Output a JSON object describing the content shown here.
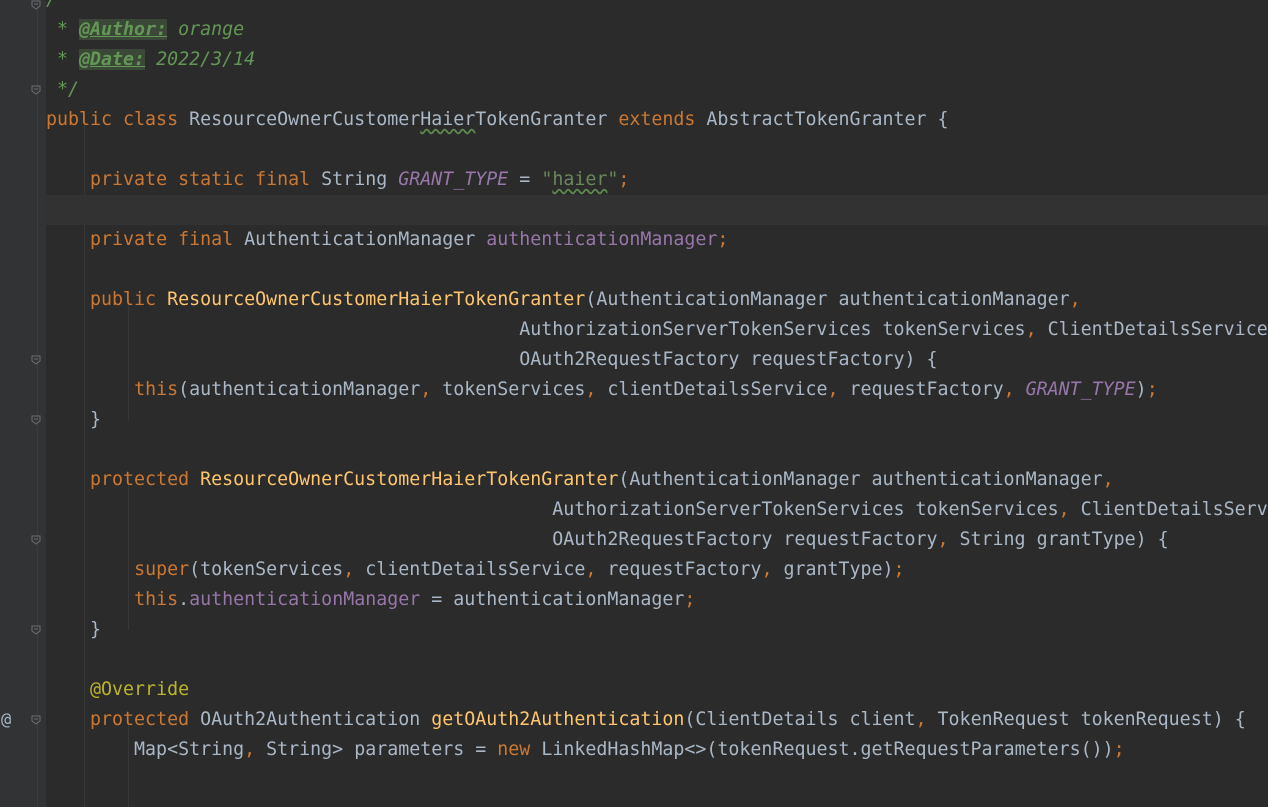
{
  "editor": {
    "gutter_marker": "@",
    "lines": [
      {
        "tokens": [
          {
            "c": "cmt",
            "t": "/**"
          }
        ]
      },
      {
        "tokens": [
          {
            "c": "cmt",
            "t": " * "
          },
          {
            "c": "tag",
            "t": "@Author:"
          },
          {
            "c": "cmt",
            "t": " orange"
          }
        ]
      },
      {
        "tokens": [
          {
            "c": "cmt",
            "t": " * "
          },
          {
            "c": "tag",
            "t": "@Date:"
          },
          {
            "c": "cmt",
            "t": " 2022/3/14"
          }
        ]
      },
      {
        "tokens": [
          {
            "c": "cmt",
            "t": " */"
          }
        ]
      },
      {
        "tokens": [
          {
            "c": "kw",
            "t": "public class "
          },
          {
            "c": "pl",
            "t": "ResourceOwnerCustomer"
          },
          {
            "c": "pl typo",
            "t": "Haier"
          },
          {
            "c": "pl",
            "t": "TokenGranter "
          },
          {
            "c": "kw",
            "t": "extends "
          },
          {
            "c": "pl",
            "t": "AbstractTokenGranter {"
          }
        ]
      },
      {
        "tokens": []
      },
      {
        "tokens": [
          {
            "c": "pl",
            "t": "    "
          },
          {
            "c": "kw",
            "t": "private static final "
          },
          {
            "c": "pl",
            "t": "String "
          },
          {
            "c": "cst",
            "t": "GRANT_TYPE"
          },
          {
            "c": "pl",
            "t": " = "
          },
          {
            "c": "str",
            "t": "\""
          },
          {
            "c": "str typo",
            "t": "haier"
          },
          {
            "c": "str",
            "t": "\""
          },
          {
            "c": "kw",
            "t": ";"
          }
        ]
      },
      {
        "tokens": [],
        "current": true
      },
      {
        "tokens": [
          {
            "c": "pl",
            "t": "    "
          },
          {
            "c": "kw",
            "t": "private final "
          },
          {
            "c": "pl",
            "t": "AuthenticationManager "
          },
          {
            "c": "fld",
            "t": "authenticationManager"
          },
          {
            "c": "kw",
            "t": ";"
          }
        ]
      },
      {
        "tokens": []
      },
      {
        "tokens": [
          {
            "c": "pl",
            "t": "    "
          },
          {
            "c": "kw",
            "t": "public "
          },
          {
            "c": "fn",
            "t": "ResourceOwnerCustomerHaierTokenGranter"
          },
          {
            "c": "pl",
            "t": "(AuthenticationManager authenticationManager"
          },
          {
            "c": "kw",
            "t": ","
          }
        ]
      },
      {
        "tokens": [
          {
            "c": "pl",
            "t": "                                           AuthorizationServerTokenServices tokenServices"
          },
          {
            "c": "kw",
            "t": ", "
          },
          {
            "c": "pl",
            "t": "ClientDetailsService clientDetailsService"
          },
          {
            "c": "kw",
            "t": ","
          }
        ]
      },
      {
        "tokens": [
          {
            "c": "pl",
            "t": "                                           OAuth2RequestFactory requestFactory) {"
          }
        ]
      },
      {
        "tokens": [
          {
            "c": "pl",
            "t": "        "
          },
          {
            "c": "kw",
            "t": "this"
          },
          {
            "c": "pl",
            "t": "(authenticationManager"
          },
          {
            "c": "kw",
            "t": ", "
          },
          {
            "c": "pl",
            "t": "tokenServices"
          },
          {
            "c": "kw",
            "t": ", "
          },
          {
            "c": "pl",
            "t": "clientDetailsService"
          },
          {
            "c": "kw",
            "t": ", "
          },
          {
            "c": "pl",
            "t": "requestFactory"
          },
          {
            "c": "kw",
            "t": ", "
          },
          {
            "c": "cst",
            "t": "GRANT_TYPE"
          },
          {
            "c": "pl",
            "t": ")"
          },
          {
            "c": "kw",
            "t": ";"
          }
        ]
      },
      {
        "tokens": [
          {
            "c": "pl",
            "t": "    }"
          }
        ]
      },
      {
        "tokens": []
      },
      {
        "tokens": [
          {
            "c": "pl",
            "t": "    "
          },
          {
            "c": "kw",
            "t": "protected "
          },
          {
            "c": "fn",
            "t": "ResourceOwnerCustomerHaierTokenGranter"
          },
          {
            "c": "pl",
            "t": "(AuthenticationManager authenticationManager"
          },
          {
            "c": "kw",
            "t": ","
          }
        ]
      },
      {
        "tokens": [
          {
            "c": "pl",
            "t": "                                              AuthorizationServerTokenServices tokenServices"
          },
          {
            "c": "kw",
            "t": ", "
          },
          {
            "c": "pl",
            "t": "ClientDetailsService clientDetailsService"
          },
          {
            "c": "kw",
            "t": ","
          }
        ]
      },
      {
        "tokens": [
          {
            "c": "pl",
            "t": "                                              OAuth2RequestFactory requestFactory"
          },
          {
            "c": "kw",
            "t": ", "
          },
          {
            "c": "pl",
            "t": "String grantType) {"
          }
        ]
      },
      {
        "tokens": [
          {
            "c": "pl",
            "t": "        "
          },
          {
            "c": "kw",
            "t": "super"
          },
          {
            "c": "pl",
            "t": "(tokenServices"
          },
          {
            "c": "kw",
            "t": ", "
          },
          {
            "c": "pl",
            "t": "clientDetailsService"
          },
          {
            "c": "kw",
            "t": ", "
          },
          {
            "c": "pl",
            "t": "requestFactory"
          },
          {
            "c": "kw",
            "t": ", "
          },
          {
            "c": "pl",
            "t": "grantType)"
          },
          {
            "c": "kw",
            "t": ";"
          }
        ]
      },
      {
        "tokens": [
          {
            "c": "pl",
            "t": "        "
          },
          {
            "c": "kw",
            "t": "this"
          },
          {
            "c": "pl",
            "t": "."
          },
          {
            "c": "fld",
            "t": "authenticationManager"
          },
          {
            "c": "pl",
            "t": " = authenticationManager"
          },
          {
            "c": "kw",
            "t": ";"
          }
        ]
      },
      {
        "tokens": [
          {
            "c": "pl",
            "t": "    }"
          }
        ]
      },
      {
        "tokens": []
      },
      {
        "tokens": [
          {
            "c": "pl",
            "t": "    "
          },
          {
            "c": "ann",
            "t": "@Override"
          }
        ]
      },
      {
        "tokens": [
          {
            "c": "pl",
            "t": "    "
          },
          {
            "c": "kw",
            "t": "protected "
          },
          {
            "c": "pl",
            "t": "OAuth2Authentication "
          },
          {
            "c": "fn",
            "t": "getOAuth2Authentication"
          },
          {
            "c": "pl",
            "t": "(ClientDetails client"
          },
          {
            "c": "kw",
            "t": ", "
          },
          {
            "c": "pl",
            "t": "TokenRequest tokenRequest) {"
          }
        ]
      },
      {
        "tokens": [
          {
            "c": "pl",
            "t": "        Map<String"
          },
          {
            "c": "kw",
            "t": ", "
          },
          {
            "c": "pl",
            "t": "String> parameters = "
          },
          {
            "c": "kw",
            "t": "new "
          },
          {
            "c": "pl",
            "t": "LinkedHashMap<>(tokenRequest.getRequestParameters())"
          },
          {
            "c": "kw",
            "t": ";"
          }
        ]
      },
      {
        "tokens": []
      }
    ]
  }
}
